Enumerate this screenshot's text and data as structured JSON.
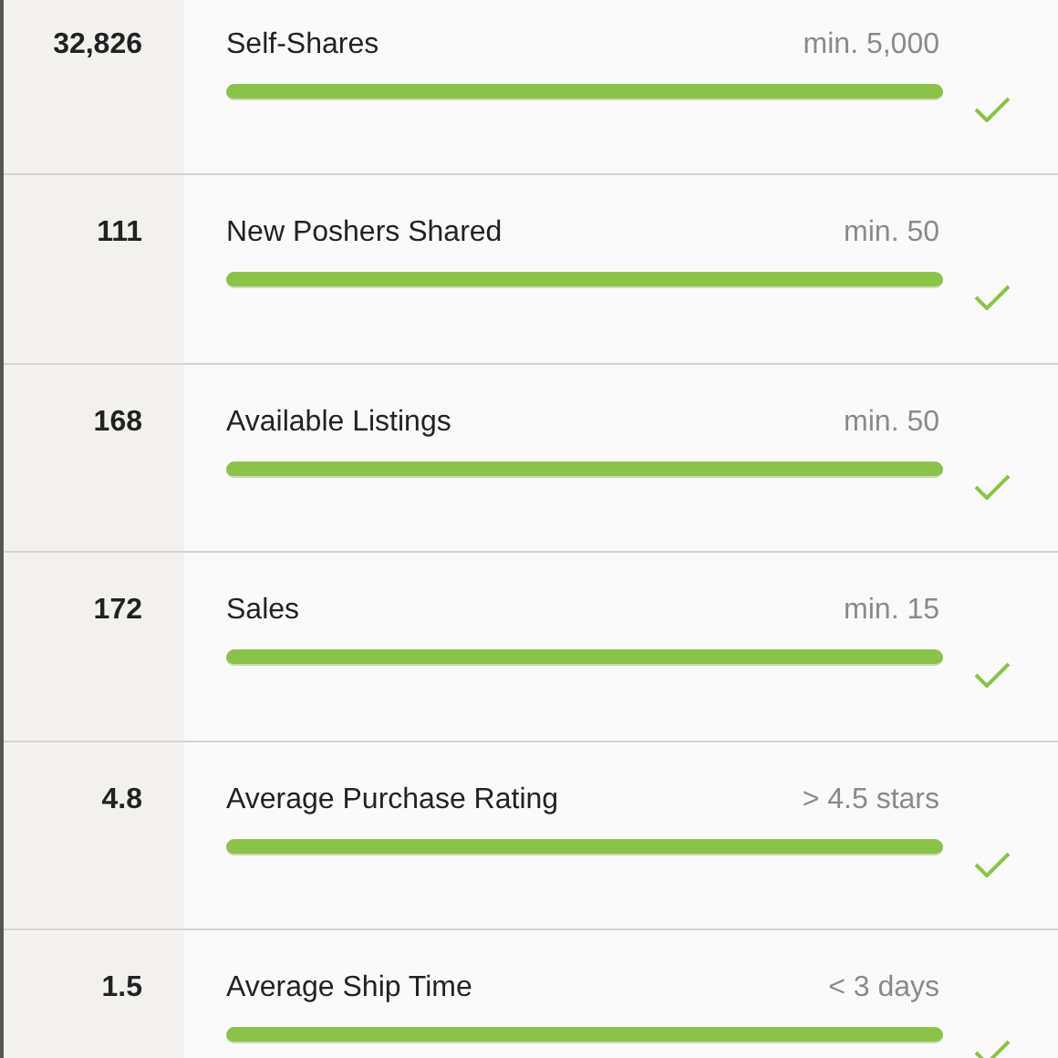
{
  "metrics": [
    {
      "value": "32,826",
      "label": "Self-Shares",
      "requirement": "min. 5,000",
      "level": 1,
      "met": true
    },
    {
      "value": "111",
      "label": "New Poshers Shared",
      "requirement": "min. 50",
      "level": 1,
      "met": true
    },
    {
      "value": "168",
      "label": "Available Listings",
      "requirement": "min. 50",
      "level": 1,
      "met": true
    },
    {
      "value": "172",
      "label": "Sales",
      "requirement": "min. 15",
      "level": 1,
      "met": true
    },
    {
      "value": "4.8",
      "label": "Average Purchase Rating",
      "requirement": "> 4.5 stars",
      "level": 1,
      "met": true
    },
    {
      "value": "1.5",
      "label": "Average Ship Time",
      "requirement": "< 3 days",
      "level": 1,
      "met": true
    }
  ]
}
